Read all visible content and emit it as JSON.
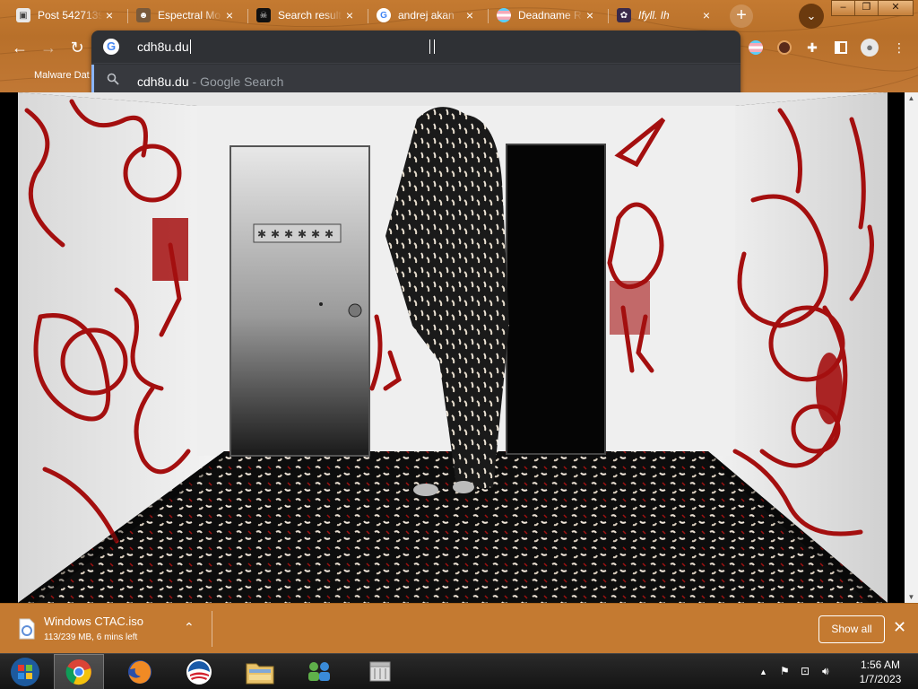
{
  "browser": {
    "tabs": [
      {
        "title": "Post 5427139",
        "favicon": "site-icon"
      },
      {
        "title": "Espectral Mo",
        "favicon": "avatar-icon"
      },
      {
        "title": "Search results",
        "favicon": "skull-icon"
      },
      {
        "title": "andrej akan",
        "favicon": "google-icon"
      },
      {
        "title": "Deadname Re",
        "favicon": "trans-flag-icon"
      },
      {
        "title": "Ifyll. Ih",
        "favicon": "anime-icon"
      }
    ],
    "new_tab_label": "+",
    "window_controls": {
      "minimize": "–",
      "maximize": "❐",
      "close": "✕"
    },
    "bookmarks": [
      {
        "label": "Malware Dat"
      }
    ],
    "theme_color": "#c47a31"
  },
  "omnibox": {
    "value": "cdh8u.du",
    "suggestion": {
      "text": "cdh8u.du",
      "suffix": " - Google Search"
    }
  },
  "page": {
    "image_description_icon": "horror-hallway-image"
  },
  "download": {
    "filename": "Windows CTAC.iso",
    "status": "113/239 MB, 6 mins left",
    "show_all_label": "Show all"
  },
  "taskbar": {
    "apps": [
      "start-orb",
      "chrome",
      "firefox",
      "obama-logo",
      "file-explorer",
      "network-users",
      "archive"
    ],
    "time": "1:56 AM",
    "date": "1/7/2023"
  }
}
